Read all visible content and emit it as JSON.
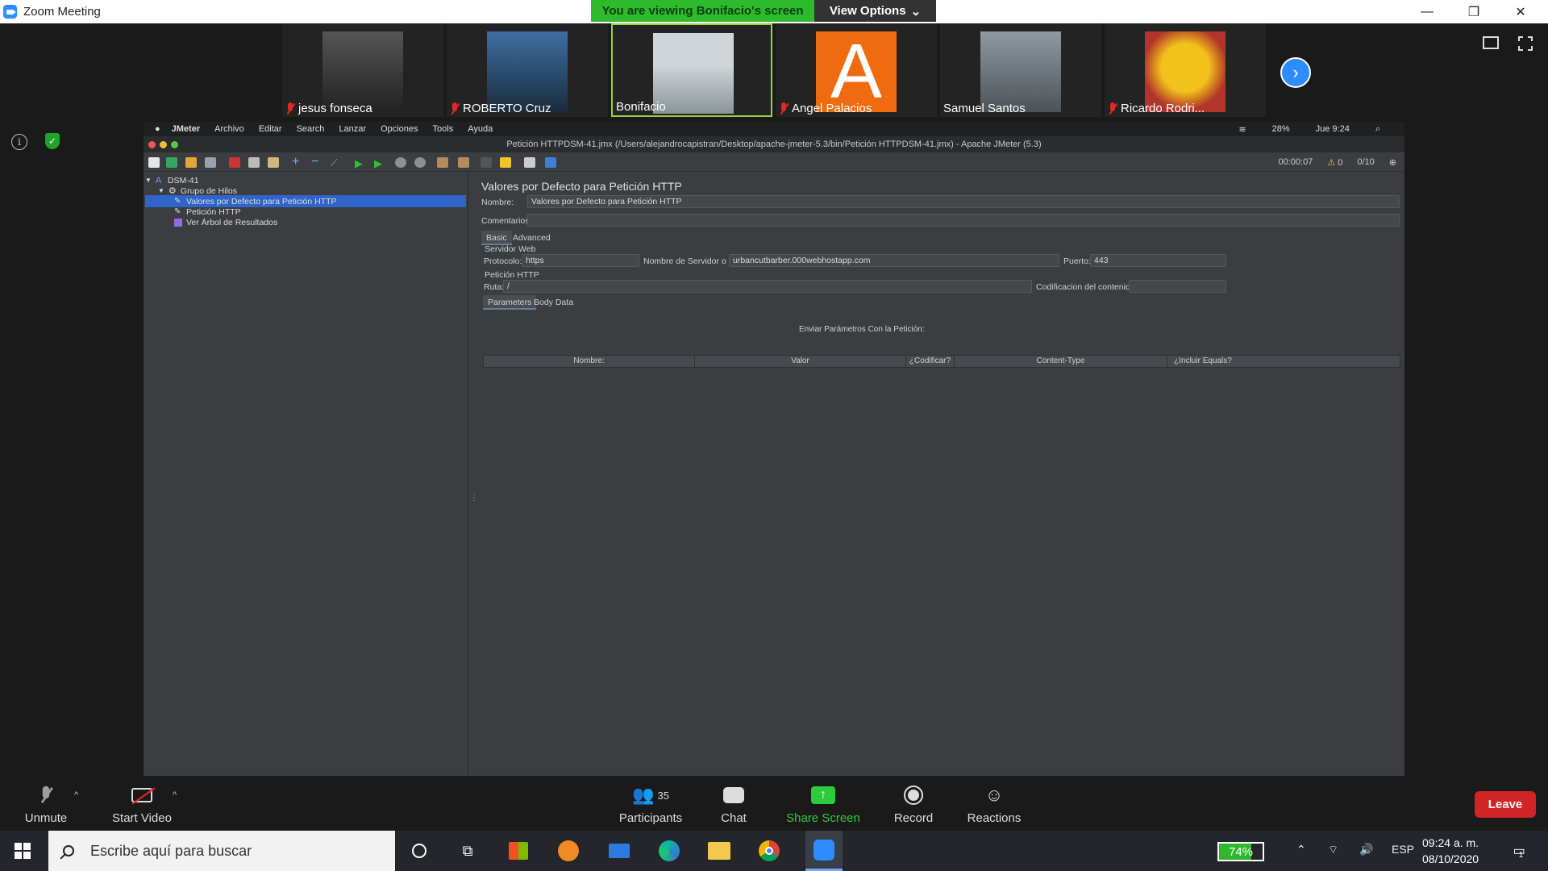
{
  "window": {
    "title": "Zoom Meeting",
    "minimize": "—",
    "restore": "❐",
    "close": "✕"
  },
  "banner": {
    "viewing": "You are viewing Bonifacio's screen",
    "view_options": "View Options"
  },
  "participants_strip": [
    {
      "name": "jesus fonseca",
      "muted": true
    },
    {
      "name": "ROBERTO Cruz",
      "muted": true
    },
    {
      "name": "Bonifacio",
      "muted": false
    },
    {
      "name": "Angel Palacios",
      "muted": true,
      "avatar_letter": "A"
    },
    {
      "name": "Samuel Santos",
      "muted": false
    },
    {
      "name": "Ricardo Rodri...",
      "muted": true
    }
  ],
  "mac": {
    "menu": [
      "JMeter",
      "Archivo",
      "Editar",
      "Search",
      "Lanzar",
      "Opciones",
      "Tools",
      "Ayuda"
    ],
    "battery": "28%",
    "clock": "Jue 9:24"
  },
  "jmeter": {
    "title": "Petición HTTPDSM-41.jmx (/Users/alejandrocapistran/Desktop/apache-jmeter-5.3/bin/Petición HTTPDSM-41.jmx) - Apache JMeter (5.3)",
    "timer": "00:00:07",
    "warnings": "0",
    "threads": "0/10",
    "tree": [
      {
        "label": "DSM-41",
        "level": 0
      },
      {
        "label": "Grupo de Hilos",
        "level": 1
      },
      {
        "label": "Valores por Defecto para Petición HTTP",
        "level": 2,
        "selected": true
      },
      {
        "label": "Petición HTTP",
        "level": 2
      },
      {
        "label": "Ver Árbol de Resultados",
        "level": 2
      }
    ],
    "panel": {
      "title": "Valores por Defecto para Petición HTTP",
      "nombre_label": "Nombre:",
      "nombre_value": "Valores por Defecto para Petición HTTP",
      "comentarios_label": "Comentarios",
      "tabs": [
        "Basic",
        "Advanced"
      ],
      "servidor_web": "Servidor Web",
      "protocolo_label": "Protocolo:",
      "protocolo_value": "https",
      "servidor_label": "Nombre de Servidor o IP:",
      "servidor_value": "urbancutbarber.000webhostapp.com",
      "puerto_label": "Puerto:",
      "puerto_value": "443",
      "peticion_http": "Petición HTTP",
      "ruta_label": "Ruta:",
      "ruta_value": "/",
      "codificacion_label": "Codificacion del contenido:",
      "param_tabs": [
        "Parameters",
        "Body Data"
      ],
      "enviar_label": "Enviar Parámetros Con la Petición:",
      "columns": [
        "Nombre:",
        "Valor",
        "¿Codificar?",
        "Content-Type",
        "¿Incluir Equals?"
      ]
    }
  },
  "controls": {
    "unmute": "Unmute",
    "start_video": "Start Video",
    "participants": "Participants",
    "participants_count": "35",
    "chat": "Chat",
    "share_screen": "Share Screen",
    "record": "Record",
    "reactions": "Reactions",
    "leave": "Leave"
  },
  "taskbar": {
    "search_placeholder": "Escribe aquí para buscar",
    "battery": "74%",
    "language": "ESP",
    "time": "09:24 a. m.",
    "date": "08/10/2020",
    "notifications": "1"
  },
  "colors": {
    "zoom_blue": "#2d8cff",
    "banner_green": "#2dbb2d",
    "leave_red": "#d12424",
    "jmeter_select": "#2f65ca"
  }
}
